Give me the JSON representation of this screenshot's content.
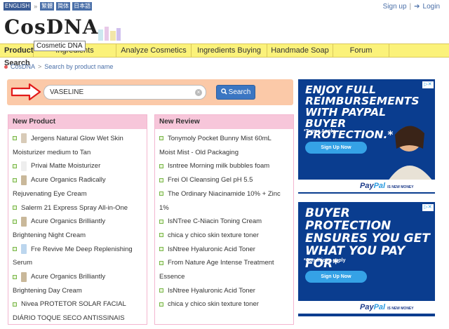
{
  "topbar": {
    "languages": [
      "ENGLISH",
      "繁體",
      "简体",
      "日本語"
    ],
    "separator": "»",
    "signup": "Sign up",
    "login": "Login",
    "divider": "|"
  },
  "logo": {
    "text": "CosDNA",
    "tooltip": "Cosmetic DNA"
  },
  "nav": {
    "items": [
      "Product Search",
      "Ingredients",
      "Analyze Cosmetics",
      "Ingredients Buying",
      "Handmade Soap",
      "Forum"
    ]
  },
  "breadcrumb": {
    "root": "CosDNA",
    "separator": ">",
    "current": "Search by product name"
  },
  "search": {
    "value": "VASELINE",
    "clear": "×",
    "button_label": "Search"
  },
  "new_product": {
    "title": "New Product",
    "items": [
      "Jergens Natural Glow Wet Skin",
      "Moisturizer medium to Tan",
      "Privai Matte Moisturizer",
      "Acure Organics Radically",
      "Rejuvenating Eye Cream",
      "Salerm 21 Express Spray All-in-One",
      "Acure Organics Brilliantly",
      "Brightening Night Cream",
      "Fre Revive Me Deep Replenishing",
      "Serum",
      "Acure Organics Brilliantly",
      "Brightening Day Cream",
      "Nivea PROTETOR SOLAR FACIAL",
      "DIÁRIO TOQUE SECO ANTISSINAIS"
    ]
  },
  "new_review": {
    "title": "New Review",
    "items": [
      "Tonymoly Pocket Bunny Mist 60mL",
      "Moist Mist - Old Packaging",
      "Isntree Morning milk bubbles foam",
      "Frei Ol Cleansing Gel pH 5.5",
      "The Ordinary Niacinamide 10% + Zinc",
      "1%",
      "IsNTree C-Niacin Toning Cream",
      "chica y chico skin texture toner",
      "IsNtree Hyaluronic Acid Toner",
      "From Nature Age Intense Treatment",
      "Essence",
      "IsNtree Hyaluronic Acid Toner",
      "chica y chico skin texture toner"
    ]
  },
  "ad1": {
    "headline": "ENJOY FULL REIMBURSEMENTS WITH PAYPAL BUYER PROTECTION.*",
    "note": "*Terms Apply",
    "button": "Sign Up Now",
    "brand_a": "Pay",
    "brand_b": "Pal",
    "tag": "IS NEW MONEY"
  },
  "ad2": {
    "headline": "BUYER PROTECTION ENSURES YOU GET WHAT YOU PAY FOR*",
    "note": "*Conditions apply",
    "button": "Sign Up Now",
    "brand_a": "Pay",
    "brand_b": "Pal",
    "tag": "IS NEW MONEY"
  },
  "colors": {
    "nav_bg": "#fbf27a",
    "panel_header": "#f7c6da",
    "search_bg": "#fbc9a8",
    "button": "#3b76c2",
    "ad_bg": "#0a3d8f"
  }
}
